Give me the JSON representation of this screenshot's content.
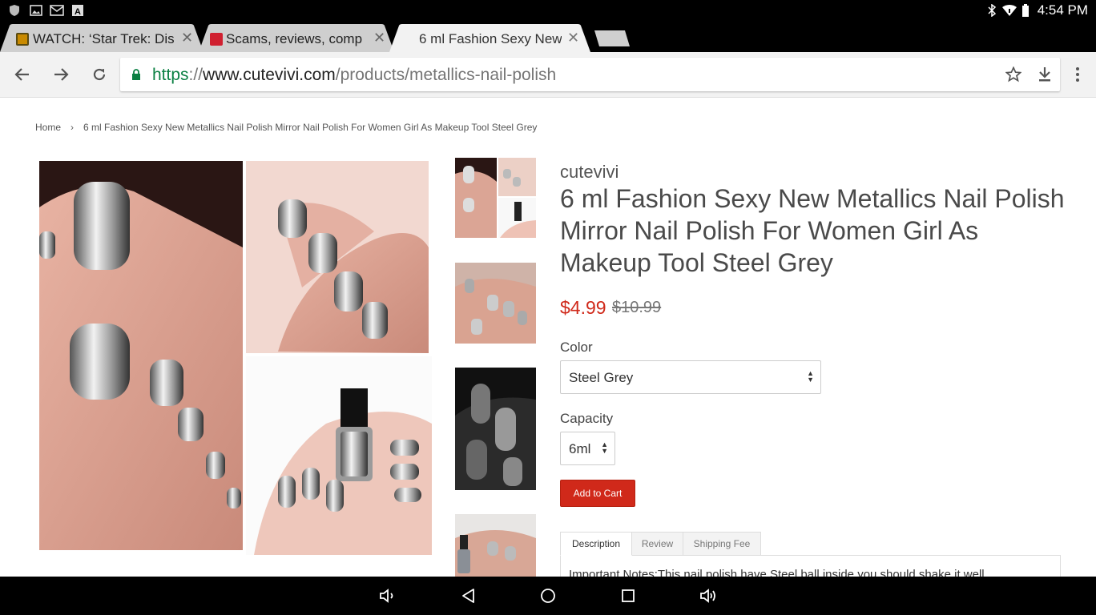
{
  "status_bar": {
    "time": "4:54 PM",
    "left_icons": [
      "shield-icon",
      "image-icon",
      "gmail-icon",
      "font-icon"
    ],
    "right_icons": [
      "bluetooth-icon",
      "wifi-icon",
      "battery-icon"
    ]
  },
  "tabs": [
    {
      "title": "WATCH: ‘Star Trek: Dis",
      "active": false,
      "favicon": "movie-icon"
    },
    {
      "title": "Scams, reviews, comp",
      "active": false,
      "favicon": "review-site-icon"
    },
    {
      "title": "6 ml Fashion Sexy New",
      "active": true
    }
  ],
  "toolbar": {
    "url_scheme": "https",
    "url_sep": "://",
    "url_host": "www.cutevivi.com",
    "url_path": "/products/metallics-nail-polish"
  },
  "breadcrumb": {
    "home": "Home",
    "separator": "›",
    "current": "6 ml Fashion Sexy New Metallics Nail Polish Mirror Nail Polish For Women Girl As Makeup Tool Steel Grey"
  },
  "product": {
    "vendor": "cutevivi",
    "title": "6 ml Fashion Sexy New Metallics Nail Polish Mirror Nail Polish For Women Girl As Makeup Tool Steel Grey",
    "price": "$4.99",
    "compare_price": "$10.99",
    "color_label": "Color",
    "color_value": "Steel Grey",
    "capacity_label": "Capacity",
    "capacity_value": "6ml",
    "add_to_cart": "Add to Cart",
    "tabs": [
      "Description",
      "Review",
      "Shipping Fee"
    ],
    "description_start": "Important Notes:This nail polish have Steel ball inside,you should shake it well"
  },
  "colors": {
    "accent": "#d0291a",
    "url_green": "#0b8043"
  }
}
